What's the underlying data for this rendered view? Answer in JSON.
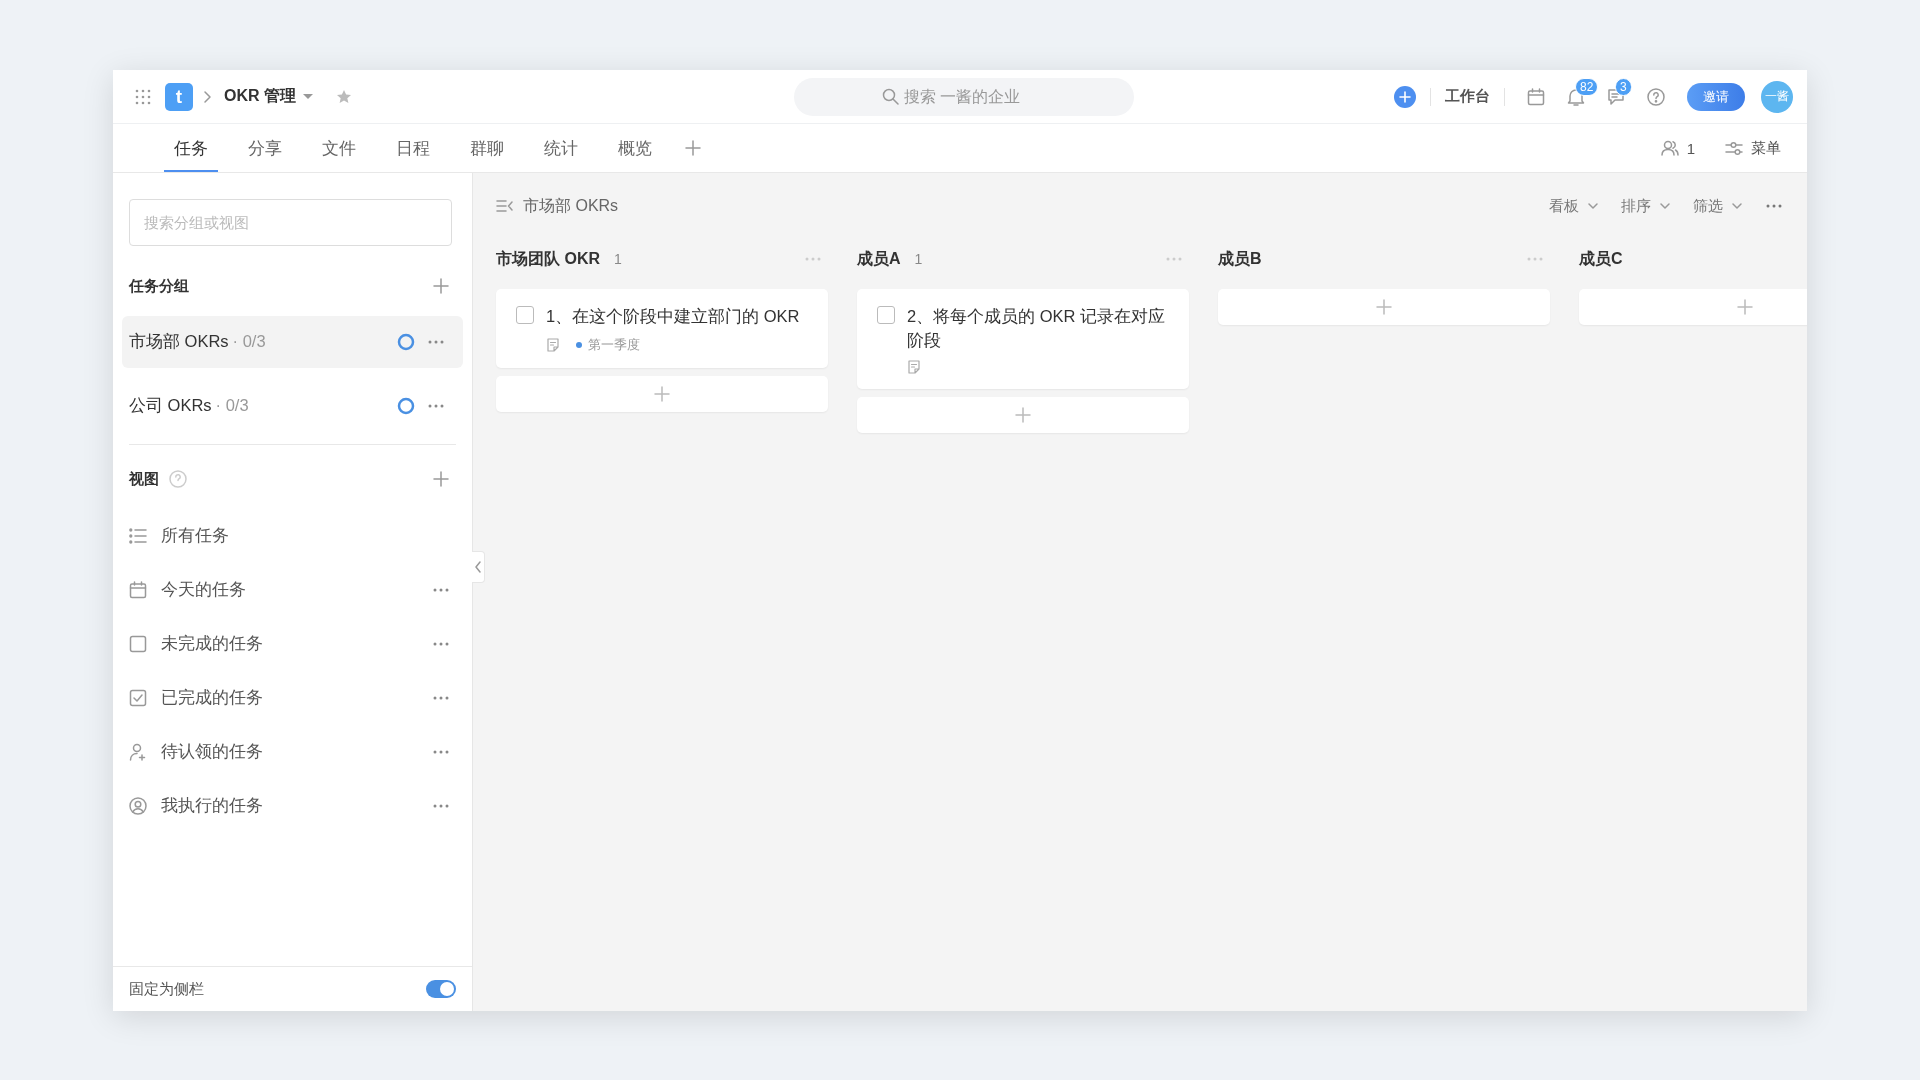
{
  "topbar": {
    "logo": "t",
    "title": "OKR 管理",
    "search": {
      "placeholder": "搜索 一酱的企业"
    },
    "workbench": "工作台",
    "notifications": "82",
    "messages": "3",
    "invite": "邀请",
    "avatar": "一酱"
  },
  "tabs": [
    {
      "label": "任务",
      "selected": true
    },
    {
      "label": "分享",
      "selected": false
    },
    {
      "label": "文件",
      "selected": false
    },
    {
      "label": "日程",
      "selected": false
    },
    {
      "label": "群聊",
      "selected": false
    },
    {
      "label": "统计",
      "selected": false
    },
    {
      "label": "概览",
      "selected": false
    }
  ],
  "tab_tools": {
    "members": "1",
    "menu": "菜单"
  },
  "sidebar": {
    "search": {
      "placeholder": "搜索分组或视图"
    },
    "groups_title": "任务分组",
    "groups": [
      {
        "name": "市场部 OKRs",
        "progress": "· 0/3",
        "selected": true
      },
      {
        "name": "公司 OKRs",
        "progress": "· 0/3",
        "selected": false
      }
    ],
    "views_title": "视图",
    "views": [
      {
        "kind": "list",
        "label": "所有任务",
        "more": false
      },
      {
        "kind": "calendar",
        "label": "今天的任务",
        "more": true
      },
      {
        "kind": "unchecked",
        "label": "未完成的任务",
        "more": true
      },
      {
        "kind": "checked",
        "label": "已完成的任务",
        "more": true
      },
      {
        "kind": "claim",
        "label": "待认领的任务",
        "more": true
      },
      {
        "kind": "mine",
        "label": "我执行的任务",
        "more": true
      }
    ],
    "pin": {
      "label": "固定为侧栏",
      "on": true
    }
  },
  "board": {
    "title": "市场部 OKRs",
    "toolbar": [
      "看板",
      "排序",
      "筛选"
    ],
    "columns": [
      {
        "title": "市场团队 OKR",
        "count": "1",
        "more": true,
        "cards": [
          {
            "text": "1、在这个阶段中建立部门的 OKR",
            "checked": false,
            "tag": {
              "label": "第一季度",
              "color": "#4a90e2"
            }
          }
        ]
      },
      {
        "title": "成员A",
        "count": "1",
        "more": true,
        "cards": [
          {
            "text": "2、将每个成员的 OKR 记录在对应阶段",
            "checked": false
          }
        ]
      },
      {
        "title": "成员B",
        "more": true
      },
      {
        "title": "成员C",
        "more": false
      }
    ]
  }
}
